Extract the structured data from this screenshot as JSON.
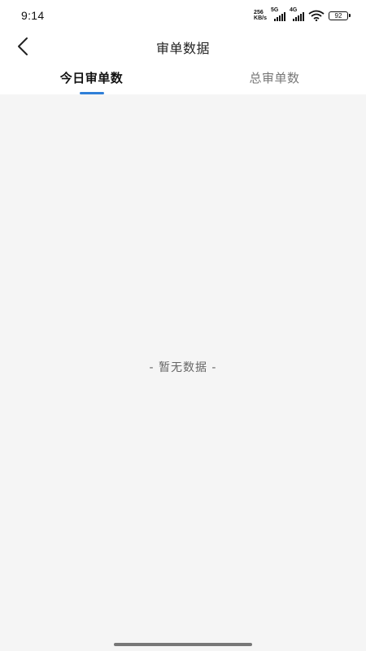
{
  "status_bar": {
    "time": "9:14",
    "net_speed_value": "256",
    "net_speed_unit": "KB/s",
    "sim1_tag": "5G",
    "sim2_tag": "4G",
    "battery": "92"
  },
  "header": {
    "back_icon": "chevron-left-icon",
    "title": "审单数据"
  },
  "tabs": [
    {
      "label": "今日审单数",
      "active": true
    },
    {
      "label": "总审单数",
      "active": false
    }
  ],
  "content": {
    "empty_text": "- 暂无数据 -"
  },
  "colors": {
    "accent": "#2f7fd8",
    "content_bg": "#f5f5f5"
  }
}
